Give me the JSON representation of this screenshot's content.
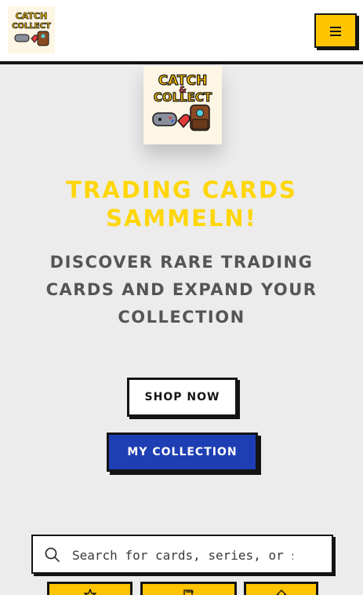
{
  "header": {
    "logo_alt": "Catch & Collect",
    "menu_icon": "hamburger-menu-icon"
  },
  "hero": {
    "logo_lines": [
      "CATCH",
      "&",
      "COLLECT"
    ],
    "title": "TRADING CARDS SAMMELN!",
    "subtitle": "DISCOVER RARE TRADING CARDS AND EXPAND YOUR COLLECTION"
  },
  "actions": {
    "shop_label": "SHOP NOW",
    "collection_label": "MY COLLECTION"
  },
  "search": {
    "placeholder": "Search for cards, series, or s",
    "icon": "search-icon"
  },
  "categories": [
    {
      "icon": "star-icon"
    },
    {
      "icon": "cards-icon"
    },
    {
      "icon": "home-icon"
    }
  ],
  "colors": {
    "accent_yellow": "#ffc400",
    "title_yellow": "#ffd60a",
    "primary_blue": "#1e3fb3",
    "outline": "#141414",
    "background": "#ececec"
  }
}
